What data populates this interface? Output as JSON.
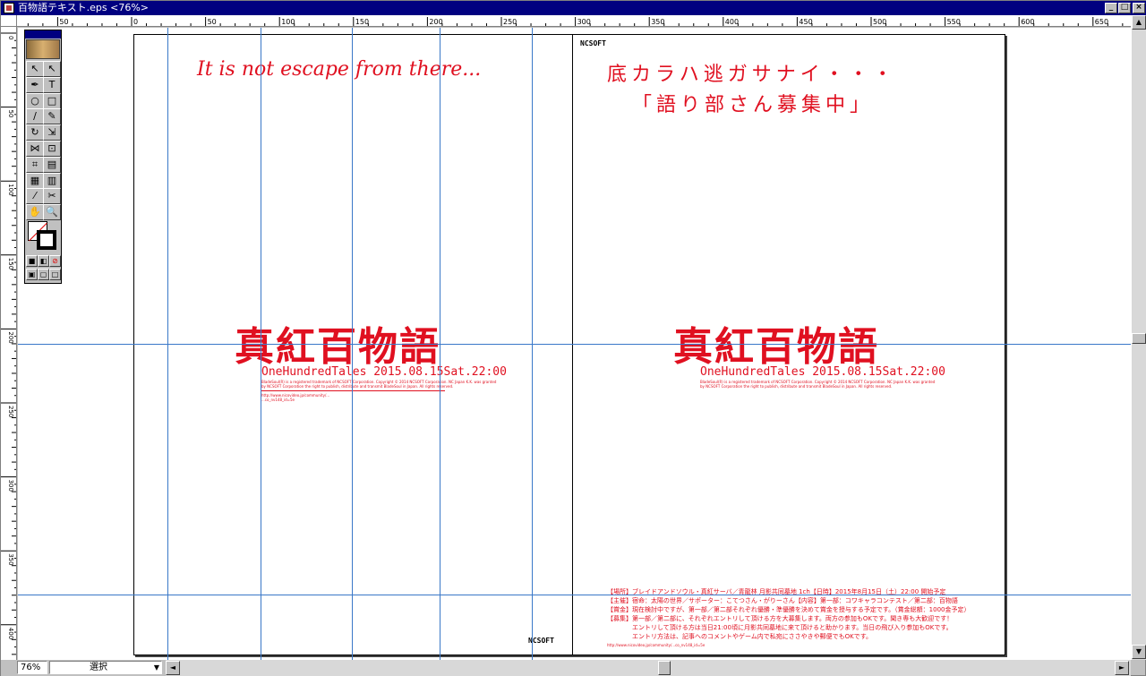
{
  "window": {
    "title": "百物語テキスト.eps <76%>",
    "minimize": "_",
    "maximize": "□",
    "close": "×"
  },
  "ruler": {
    "top_labels": [
      "50",
      "0",
      "50",
      "100",
      "150",
      "200",
      "250",
      "300",
      "350",
      "400",
      "450",
      "500",
      "550",
      "600",
      "650"
    ],
    "left_labels": [
      "0",
      "50",
      "100",
      "150",
      "200",
      "250",
      "300",
      "350",
      "400"
    ]
  },
  "status": {
    "zoom": "76%",
    "mode": "選択",
    "dropdown_arrow": "▼",
    "left_arrow": "◄",
    "right_arrow": "►",
    "up_arrow": "▲",
    "down_arrow": "▼"
  },
  "toolbox": {
    "tools": [
      "↖",
      "↖",
      "✒",
      "T",
      "○",
      "□",
      "∕",
      "✎",
      "↻",
      "⇲",
      "⋈",
      "⊡",
      "⌗",
      "▤",
      "▦",
      "▥",
      "⁄",
      "✂",
      "✋",
      "🔍"
    ]
  },
  "left_page": {
    "tagline": "It is not escape from there...",
    "title": "真紅百物語",
    "subtitle": "OneHundredTales 2015.08.15Sat.22:00",
    "fine_line1": "BladeSoul(R) is a registered trademark of NCSOFT Corporation. Copyright © 2014 NCSOFT Corporation. NC Japan K.K. was granted",
    "fine_line2": "by NCSOFT Corporation the right to publish, distribute and transmit BladeSoul in Japan. All rights reserved.",
    "fine_url1": "http://www.nicovideo.jp/community/...",
    "fine_url2": "...co_nv148_id=5e",
    "logo": "NCSOFT"
  },
  "right_page": {
    "logo": "NCSOFT",
    "headline1": "底カラハ逃ガサナイ・・・",
    "headline2": "「語り部さん募集中」",
    "title": "真紅百物語",
    "subtitle": "OneHundredTales 2015.08.15Sat.22:00",
    "fine_line1": "BladeSoul(R) is a registered trademark of NCSOFT Corporation. Copyright © 2014 NCSOFT Corporation. NC Japan K.K. was granted",
    "fine_line2": "by NCSOFT Corporation the right to publish, distribute and transmit BladeSoul in Japan. All rights reserved.",
    "info": [
      "【場所】ブレイドアンドソウル・真紅サーバ／青龍林 月影共同墓地 1ch【日時】2015年8月15日（土）22:00 開始予定",
      "【主催】宿命：太陽の世界／サポーター：こてつさん・がりーさん【内容】第一部：コワキャラコンテスト／第二部：百物語",
      "【賞金】現在検討中ですが、第一部／第二部それぞれ優勝・準優勝を決めて賞金を授与する予定です。（賞金総額：1000金予定）",
      "【募集】第一部／第二部に、それぞれエントリして頂ける方を大募集します。両方の参加もOKです。聞き専も大歓迎です！",
      "エントリして頂ける方は当日21:00頃に月影共同墓地に来て頂けると助かります。当日の飛び入り参加もOKです。",
      "エントリ方法は、記事へのコメントやゲーム内で私宛にささやきや郵便でもOKです。"
    ],
    "info_url": "http://www.nicovideo.jp/community/...co_nv148_id=5e"
  }
}
